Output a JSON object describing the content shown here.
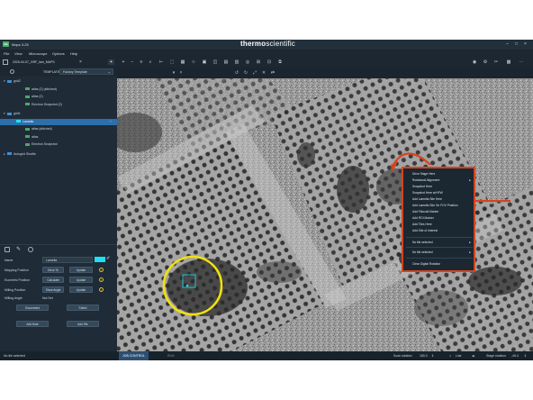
{
  "app": {
    "logo": "Mp",
    "title": "Maps 3.25",
    "brand_bold": "thermo",
    "brand_light": "scientific"
  },
  "menu": [
    "File",
    "View",
    "Microscope",
    "Options",
    "Help"
  ],
  "project": {
    "tab_label": "2025-04-07_GRF_lam_MAPS",
    "template_label": "TEMPLATE",
    "template_value": "Factory Template"
  },
  "tree": [
    {
      "label": "grid2",
      "level": 0,
      "expanded": true,
      "selected": false,
      "icon": "folder-icon",
      "icon_color": "#3d8fd6"
    },
    {
      "label": "atlas (2) (stitched)",
      "level": 2,
      "selected": false,
      "icon": "image-icon",
      "icon_color": "#4aa86a"
    },
    {
      "label": "atlas (2)",
      "level": 2,
      "selected": false,
      "icon": "image-icon",
      "icon_color": "#4aa86a"
    },
    {
      "label": "Electron Snapshot (2)",
      "level": 2,
      "selected": false,
      "icon": "image-icon",
      "icon_color": "#4aa86a"
    },
    {
      "label": "grid1",
      "level": 0,
      "expanded": true,
      "selected": false,
      "icon": "folder-icon",
      "icon_color": "#3d8fd6"
    },
    {
      "label": "Lamella",
      "level": 1,
      "selected": true,
      "icon": "lamella-icon",
      "icon_color": "#1ee0f0"
    },
    {
      "label": "atlas (stitched)",
      "level": 2,
      "selected": false,
      "icon": "image-icon",
      "icon_color": "#4aa86a"
    },
    {
      "label": "atlas",
      "level": 2,
      "selected": false,
      "icon": "image-icon",
      "icon_color": "#4aa86a"
    },
    {
      "label": "Electron Snapshot",
      "level": 2,
      "selected": false,
      "icon": "image-icon",
      "icon_color": "#4aa86a"
    },
    {
      "label": "Autogrid Shuttle",
      "level": 0,
      "expanded": false,
      "selected": false,
      "icon": "folder-icon",
      "icon_color": "#3d8fd6"
    }
  ],
  "properties": {
    "name_label": "Name",
    "name_value": "Lamella",
    "mapping_label": "Mapping Position",
    "mapping_btn1": "Drive To",
    "mapping_btn2": "Update",
    "eucentric_label": "Eucentric Position",
    "eucentric_btn1": "Calculate",
    "eucentric_btn2": "Update",
    "milling_label": "Milling Position",
    "milling_btn1": "Show Angle",
    "milling_btn2": "Update",
    "milling_angle_label": "Milling Angle",
    "milling_angle_value": "Not Set",
    "succeeded_btn": "Succeeded",
    "failed_btn": "Failed",
    "add_note_btn": "Add Note",
    "add_file_btn": "Add File",
    "badge_info": "i",
    "lamella_color": "#1ee0f0"
  },
  "status": {
    "left": "No tile selected",
    "tab_job": "JOB CONTROL",
    "tab_run": "RUN",
    "scan_rotation_label": "Scan rotation",
    "scan_rotation_value": "180.0",
    "link_label": "Link",
    "stage_rotation_label": "Stage rotation",
    "stage_rotation_value": "-49.4"
  },
  "context_menu": {
    "items": [
      {
        "label": "Drive Stage Here",
        "submenu": false
      },
      {
        "label": "Rotational Alignment",
        "submenu": true
      },
      {
        "label": "Snapshot Here",
        "submenu": false
      },
      {
        "label": "Snapshot Here w/HFW",
        "submenu": false
      },
      {
        "label": "Add Lamella Site Here",
        "submenu": false
      },
      {
        "label": "Add Lamella Site On FOV Position",
        "submenu": false
      },
      {
        "label": "Add Fiducial Marker",
        "submenu": false
      },
      {
        "label": "Add ROI Marker",
        "submenu": false
      },
      {
        "label": "Add Tiles Here",
        "submenu": false
      },
      {
        "label": "Add Site of Interest",
        "submenu": false
      },
      {
        "label": "No tile selected",
        "submenu": true
      },
      {
        "label": "No tile selected",
        "submenu": true
      },
      {
        "label": "Clear Digital Rotation",
        "submenu": false
      }
    ],
    "border_color": "#d5441e"
  },
  "annotations": {
    "circle_color": "#f0e10f",
    "arrow_color": "#d5441e"
  }
}
